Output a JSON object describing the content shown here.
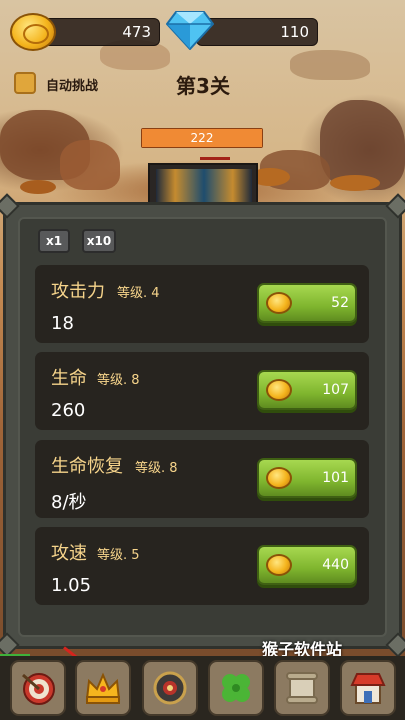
{
  "currency": {
    "gold": "473",
    "diamond": "110"
  },
  "auto_challenge": {
    "label": "自动挑战"
  },
  "level": {
    "title": "第3关"
  },
  "enemy": {
    "hp": "222"
  },
  "multiplier_tabs": [
    {
      "label": "x1"
    },
    {
      "label": "x10"
    }
  ],
  "stats": [
    {
      "name": "攻击力",
      "level_text": "等级. 4",
      "value": "18",
      "price": "52"
    },
    {
      "name": "生命",
      "level_text": "等级. 8",
      "value": "260",
      "price": "107"
    },
    {
      "name": "生命恢复",
      "level_text": "等级. 8",
      "value": "8/秒",
      "price": "101"
    },
    {
      "name": "攻速",
      "level_text": "等级. 5",
      "value": "1.05",
      "price": "440"
    }
  ],
  "nav_items": [
    {
      "icon": "target-icon"
    },
    {
      "icon": "crown-icon"
    },
    {
      "icon": "compass-icon"
    },
    {
      "icon": "clover-icon"
    },
    {
      "icon": "scroll-icon"
    },
    {
      "icon": "shop-icon"
    }
  ],
  "watermark": "猴子软件站",
  "colors": {
    "gold": "#f4b41d",
    "buy_button": "#7fb52e",
    "stat_text": "#f6d48b",
    "panel": "#4a4d46"
  }
}
